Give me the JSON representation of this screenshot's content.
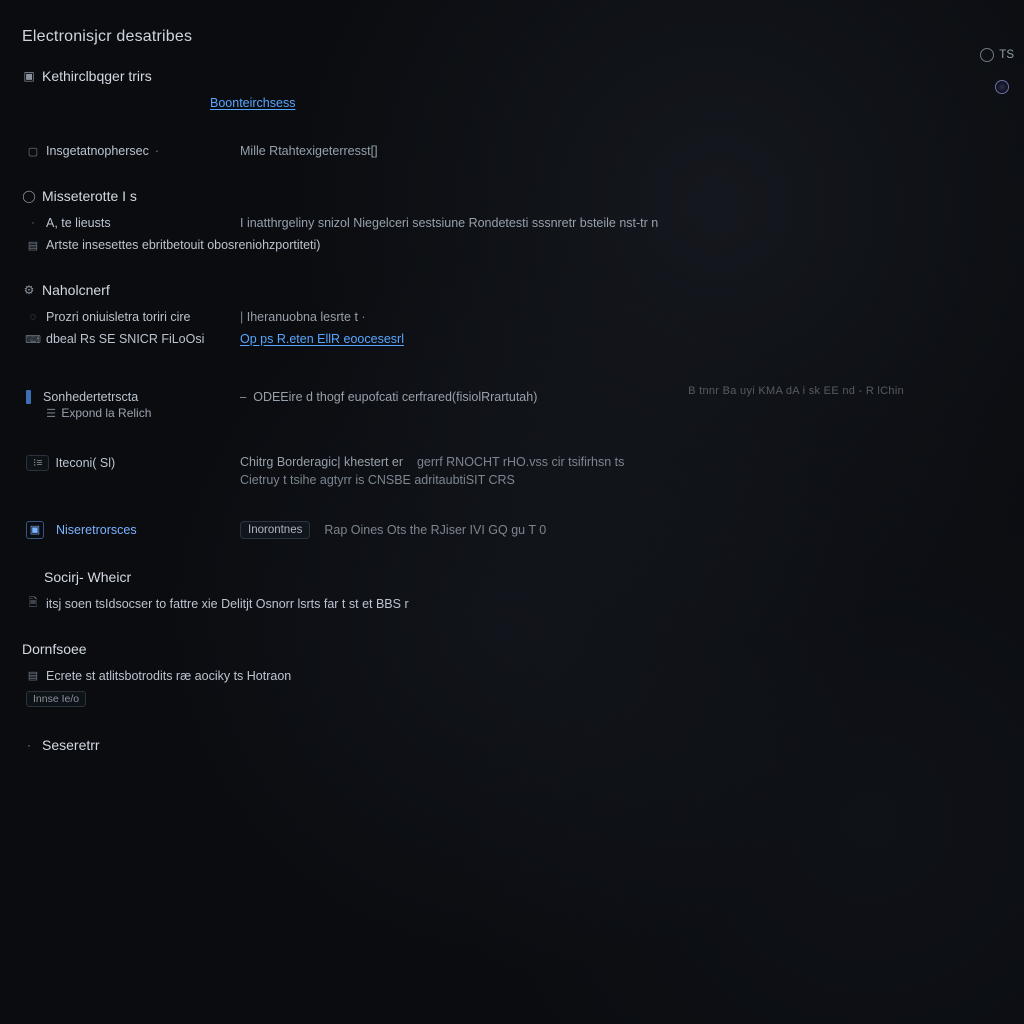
{
  "page": {
    "title": "Electronisjcr desatribes"
  },
  "topRight": {
    "time": "TS",
    "cpu": ""
  },
  "authoring": {
    "heading": "Kethirclbqger trirs",
    "link": "Boonteirchsess"
  },
  "item1": {
    "label": "Insgetatnophersec",
    "value": "Mille Rtahtexigeterresst[]"
  },
  "missetrotte": {
    "heading": "Misseterotte I s",
    "row1_left": "A, te lieusts",
    "row1_right": "I inatthrgeliny snizol Niegelceri sestsiune Rondetesti sssnretr bsteile nst-tr n",
    "row2": "Artste insesettes ebritbetouit obosreniohzportiteti)"
  },
  "nahobnet": {
    "heading": "Naholcnerf",
    "row1_left": "Prozri oniuisletra toriri cire",
    "row1_right": "Iheranuobna lesrte t",
    "row2_left": "dbeal Rs SE SNICR FiLoOsi",
    "row2_link": "Op ps R.eten EllR eoocesesrl",
    "faint": "B tnnr Ba uyi KMA dA i sk EE nd - R lChin"
  },
  "sonheder": {
    "row1_left": "Sonhedertetrscta",
    "row1_sub": "Expond la Relich",
    "row1_right": "ODEEire d thogf eupofcati cerfrared(fisiolRrartutah)"
  },
  "teconi": {
    "label": "Iteconi( Sl)",
    "right_line1": "Chitrg Borderagic| khestert er",
    "right_sub1": "gerrf RNOCHT rHO.vss cir tsifirhsn ts",
    "right_sub2": "Cietruy t tsihe agtyrr is CNSBE adritaubtiSIT CRS"
  },
  "nisertroes": {
    "label": "Niseretrorsces",
    "chip": "Inorontnes",
    "right": "Rap Oines Ots the RJiser IVI GQ gu T 0"
  },
  "socirj": {
    "heading": "Socirj- Wheicr",
    "row": "itsj soen tsIdsocser to fattre xie Delitjt Osnorr lsrts far t st et BBS r",
    "row_prefix": ""
  },
  "dornfsoe": {
    "heading": "Dornfsoee",
    "row": "Ecrete st atlitsbotrodits ræ aociky ts Hotraon",
    "pill": "Innse Ie/o"
  },
  "last": {
    "heading": "Seseretrr"
  }
}
